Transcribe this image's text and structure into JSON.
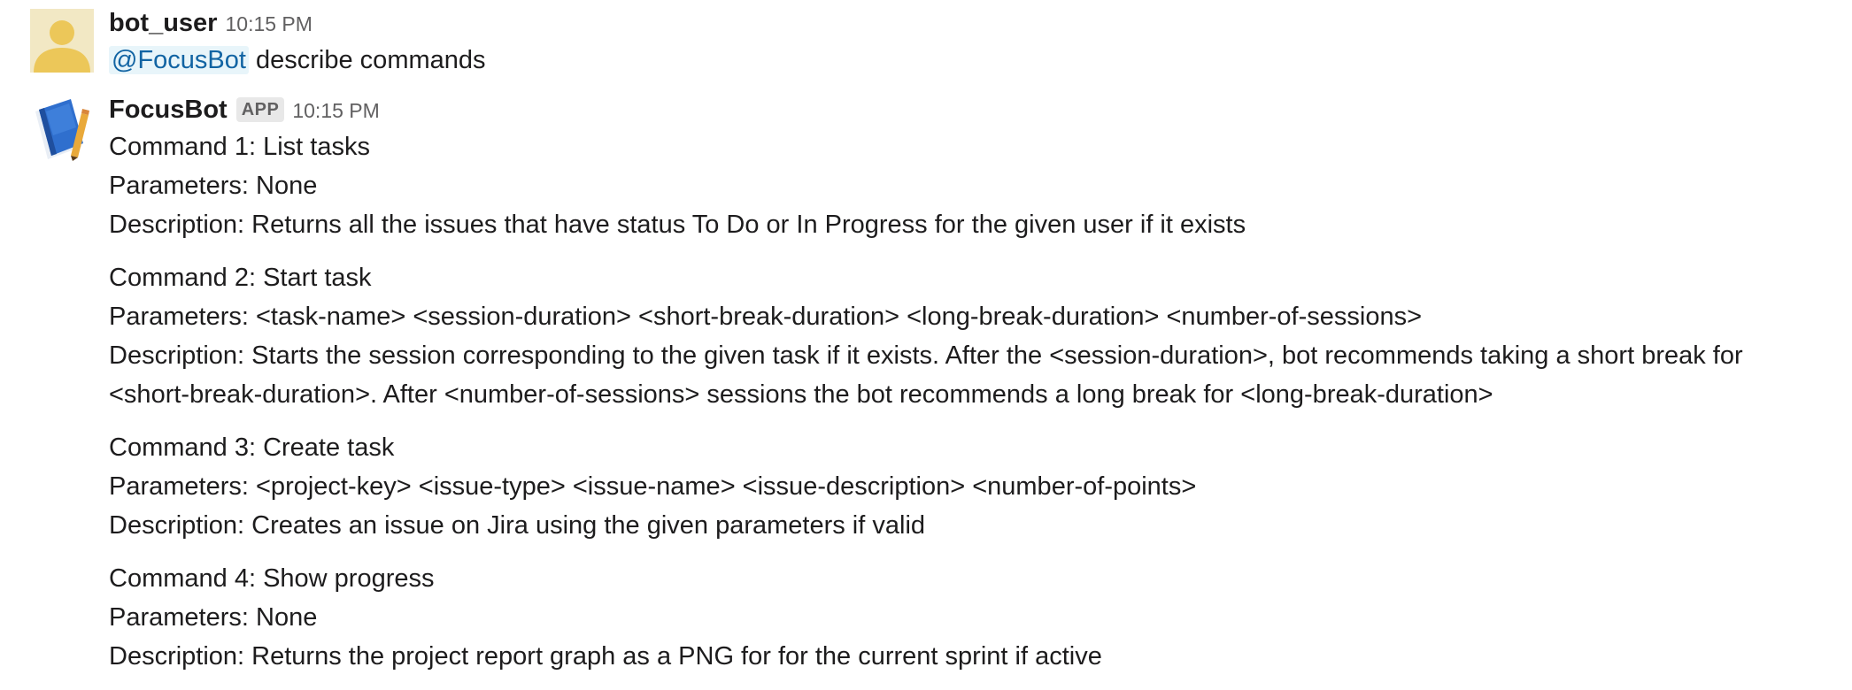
{
  "messages": [
    {
      "user": "bot_user",
      "time": "10:15 PM",
      "mention": "@FocusBot",
      "text": "describe commands"
    },
    {
      "user": "FocusBot",
      "badge": "APP",
      "time": "10:15 PM",
      "commands": [
        {
          "title": "Command 1: List tasks",
          "parameters": "Parameters: None",
          "description": "Description: Returns all the issues that have status To Do or In Progress for the given user if it exists"
        },
        {
          "title": "Command 2: Start task",
          "parameters": "Parameters: <task-name> <session-duration> <short-break-duration> <long-break-duration> <number-of-sessions>",
          "description": "Description: Starts the session corresponding to the given task if it exists. After the <session-duration>, bot recommends taking a short break for <short-break-duration>. After <number-of-sessions> sessions the bot recommends a long break for <long-break-duration>"
        },
        {
          "title": "Command 3: Create task",
          "parameters": "Parameters: <project-key> <issue-type> <issue-name> <issue-description> <number-of-points>",
          "description": "Description: Creates an issue on Jira using the given parameters if valid"
        },
        {
          "title": "Command 4: Show progress",
          "parameters": "Parameters: None",
          "description": "Description: Returns the project report graph as a PNG for for the current sprint if active"
        }
      ]
    }
  ],
  "icons": {
    "user_avatar": "user-silhouette-icon",
    "bot_avatar": "blue-book-pencil-icon"
  },
  "colors": {
    "user_avatar_bg": "#f2e8c4",
    "user_avatar_fg": "#ecc759",
    "mention_text": "#1264a3",
    "mention_bg": "#e8f5fa",
    "book_blue": "#2f6fce"
  }
}
